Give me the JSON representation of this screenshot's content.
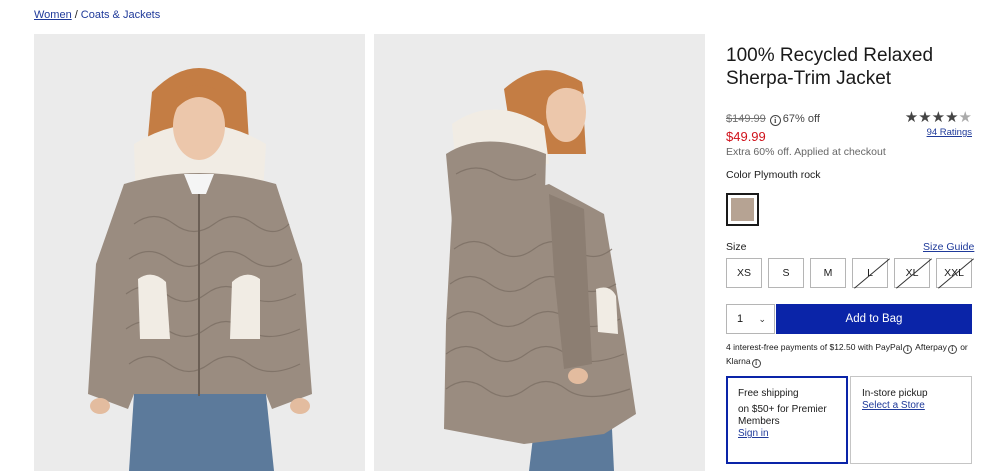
{
  "breadcrumb": {
    "parent": "Women",
    "separator": "/",
    "current": "Coats & Jackets"
  },
  "product": {
    "title": "100% Recycled Relaxed Sherpa-Trim Jacket",
    "original_price": "$149.99",
    "percent_off": "67% off",
    "sale_price": "$49.99",
    "extra_discount": "Extra 60% off. Applied at checkout"
  },
  "rating": {
    "stars": 4.5,
    "stars_text": "★★★★",
    "half_star": "★",
    "count_link": "94 Ratings"
  },
  "color": {
    "label": "Color Plymouth rock",
    "swatch_hex": "#b6a393"
  },
  "size": {
    "label": "Size",
    "guide_link": "Size Guide",
    "options": [
      {
        "label": "XS",
        "available": true
      },
      {
        "label": "S",
        "available": true
      },
      {
        "label": "M",
        "available": true
      },
      {
        "label": "L",
        "available": false
      },
      {
        "label": "XL",
        "available": false
      },
      {
        "label": "XXL",
        "available": false
      }
    ]
  },
  "quantity": {
    "value": "1",
    "chevron_icon": "chevron-down-icon"
  },
  "add_to_bag": {
    "label": "Add to Bag",
    "color": "#0a24a8"
  },
  "payments": {
    "text_1": "4 interest-free payments of $12.50 with",
    "paypal": "PayPal",
    "afterpay": "Afterpay",
    "or": "or",
    "klarna": "Klarna"
  },
  "fulfillment": {
    "shipping": {
      "title": "Free shipping",
      "detail": "on $50+ for Premier Members",
      "link": "Sign in"
    },
    "pickup": {
      "title": "In-store pickup",
      "link": "Select a Store"
    }
  },
  "colors": {
    "link": "#1f3a9a",
    "sale": "#d0121b"
  }
}
